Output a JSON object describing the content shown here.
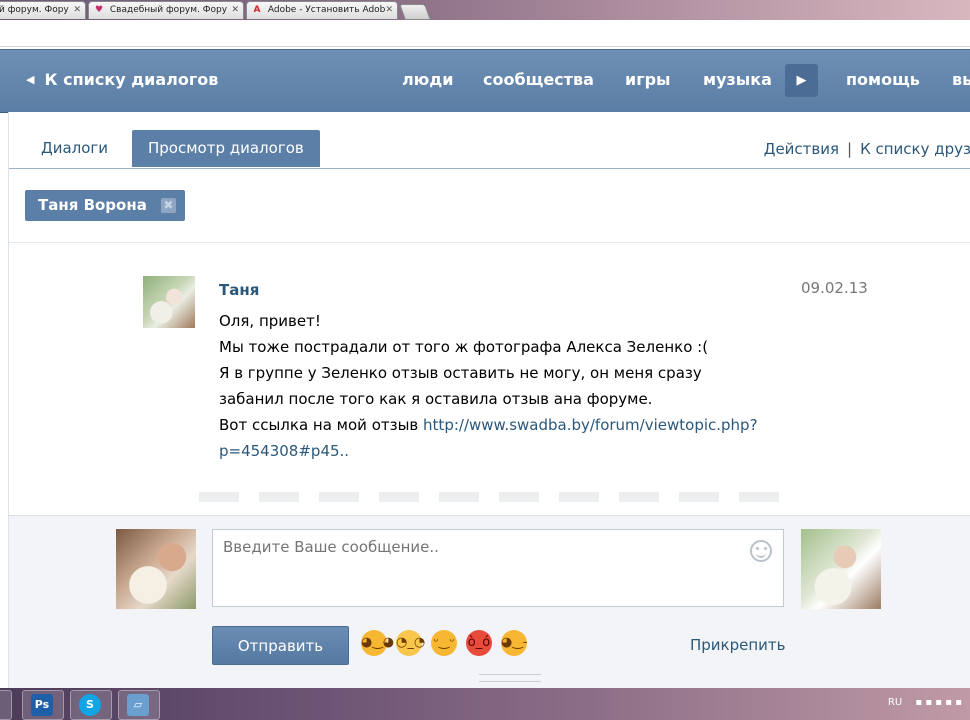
{
  "browser": {
    "tabs": [
      {
        "label": "й форум. Фору",
        "icon": "forum-favicon"
      },
      {
        "label": "Свадебный форум. Фору",
        "icon": "hearts-favicon"
      },
      {
        "label": "Adobe - Установить Adob",
        "icon": "adobe-favicon"
      }
    ],
    "close_glyph": "✕"
  },
  "header": {
    "back_label": "К списку диалогов",
    "back_arrow": "◀",
    "nav": [
      "люди",
      "сообщества",
      "игры",
      "музыка",
      "помощь",
      "вы"
    ],
    "more_arrow": "▶"
  },
  "tabs": {
    "dialogs": "Диалоги",
    "view_dialogs": "Просмотр диалогов"
  },
  "links": {
    "actions": "Действия",
    "separator": "|",
    "friends_list": "К списку друз"
  },
  "chip": {
    "name": "Таня Ворона",
    "remove": "✖"
  },
  "message": {
    "author": "Таня",
    "date": "09.02.13",
    "lines": [
      "Оля, привет!",
      "Мы тоже пострадали от того ж фотографа Алекса Зеленко :(",
      "Я в группе у Зеленко отзыв оставить не могу, он меня сразу",
      "забанил после того как я оставила отзыв ана форуме."
    ],
    "link_prefix": "Вот ссылка на мой отзыв ",
    "link_line1": "http://www.swadba.by/forum/viewtopic.php?",
    "link_line2": "p=454308#p45.."
  },
  "compose": {
    "placeholder": "Введите Ваше сообщение..",
    "send_label": "Отправить",
    "attach_label": "Прикрепить",
    "emojis": [
      {
        "name": "smile",
        "glyph": "◕‿◕",
        "color": "#f7b733"
      },
      {
        "name": "eyeroll",
        "glyph": "◔_◔",
        "color": "#f7c64a"
      },
      {
        "name": "relieved",
        "glyph": "ᵕ‿ᵕ",
        "color": "#f7b733"
      },
      {
        "name": "angry",
        "glyph": "ò_ó",
        "color": "#e64b3c"
      },
      {
        "name": "wink",
        "glyph": "◕‿-",
        "color": "#f7b733"
      }
    ]
  },
  "taskbar": {
    "items": [
      {
        "label": "Ps",
        "color": "#1f5fa8"
      },
      {
        "label": "S",
        "color": "#12a5e6"
      },
      {
        "label": "▱",
        "color": "#6a9fd0"
      }
    ],
    "lang": "RU"
  }
}
